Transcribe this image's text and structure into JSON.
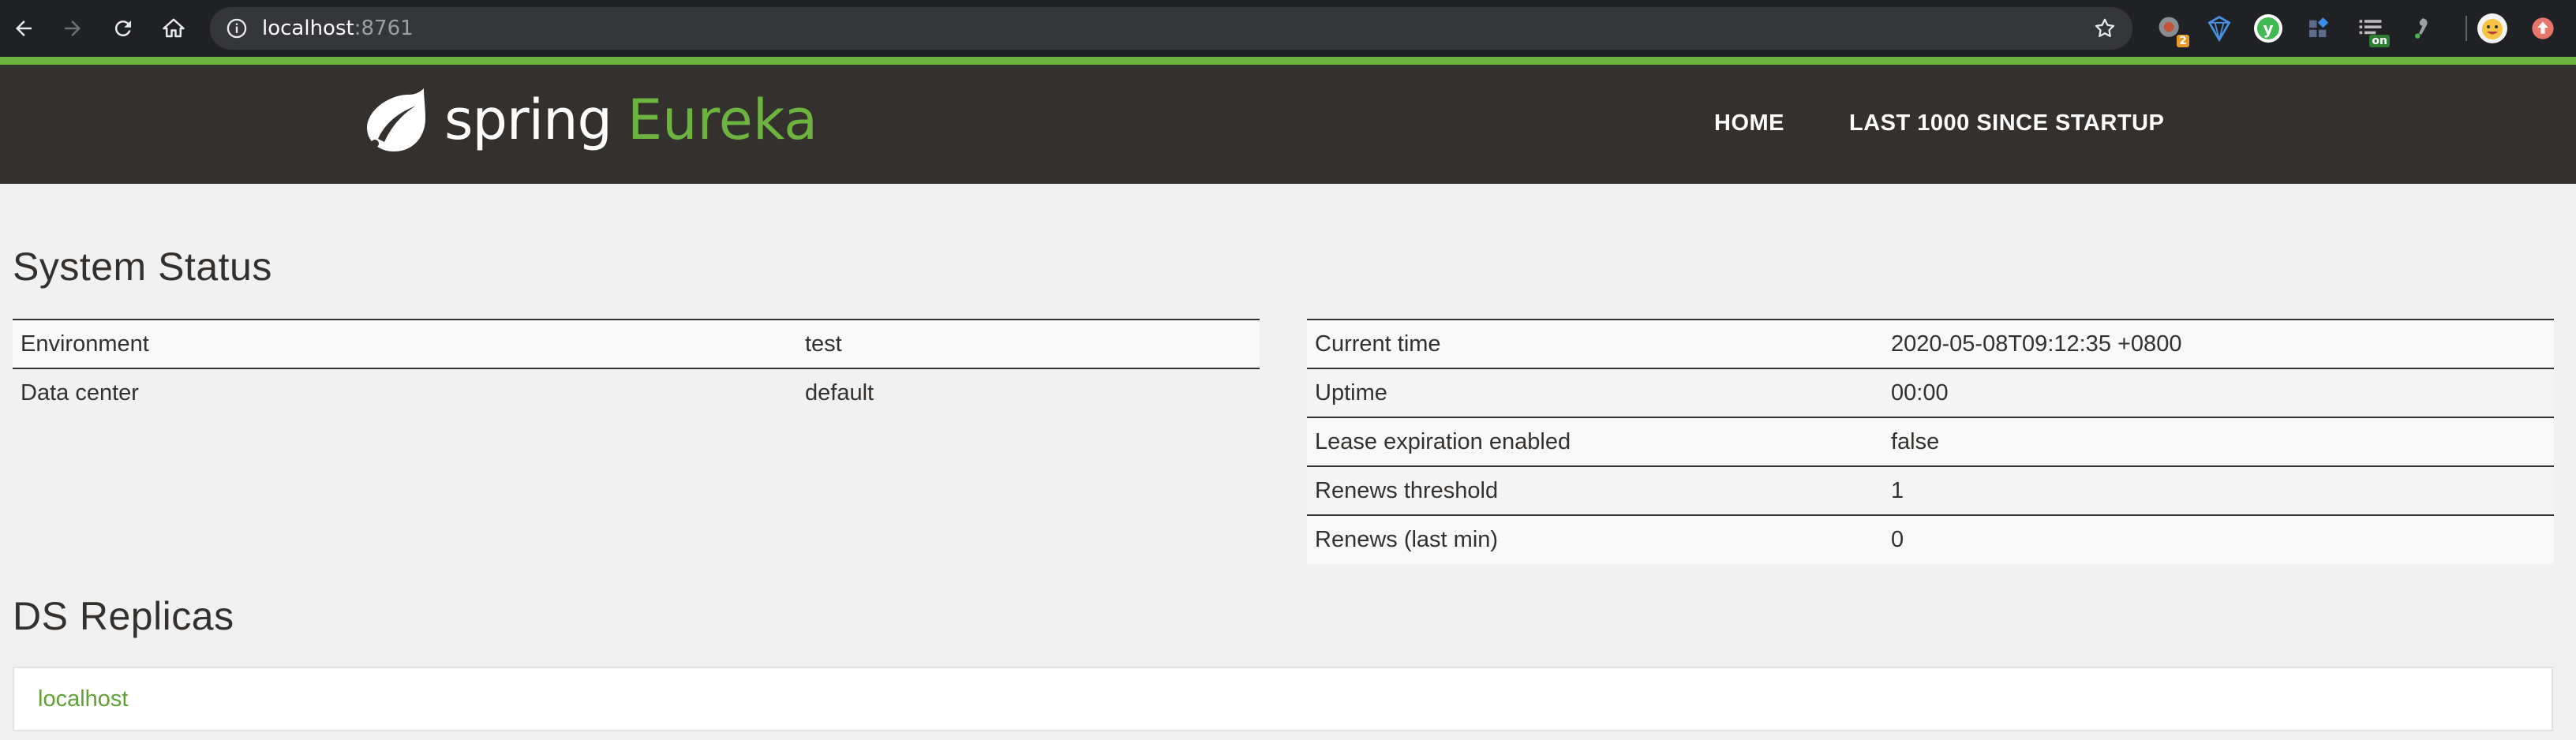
{
  "browser": {
    "url_host": "localhost",
    "url_port": ":8761",
    "extensions": [
      {
        "name": "extension-1",
        "badge": "2"
      },
      {
        "name": "extension-2",
        "badge": ""
      },
      {
        "name": "extension-3",
        "badge": ""
      },
      {
        "name": "extension-4",
        "badge": ""
      },
      {
        "name": "extension-5",
        "badge": "on"
      },
      {
        "name": "extension-6",
        "badge": ""
      }
    ]
  },
  "header": {
    "logo_spring": "spring",
    "logo_eureka": "Eureka",
    "nav": [
      {
        "label": "HOME"
      },
      {
        "label": "LAST 1000 SINCE STARTUP"
      }
    ]
  },
  "system_status": {
    "title": "System Status",
    "left_table": [
      {
        "label": "Environment",
        "value": "test"
      },
      {
        "label": "Data center",
        "value": "default"
      }
    ],
    "right_table": [
      {
        "label": "Current time",
        "value": "2020-05-08T09:12:35 +0800"
      },
      {
        "label": "Uptime",
        "value": "00:00"
      },
      {
        "label": "Lease expiration enabled",
        "value": "false"
      },
      {
        "label": "Renews threshold",
        "value": "1"
      },
      {
        "label": "Renews (last min)",
        "value": "0"
      }
    ]
  },
  "ds_replicas": {
    "title": "DS Replicas",
    "items": [
      {
        "label": "localhost"
      }
    ]
  },
  "colors": {
    "brand_green": "#6db33f",
    "header_bg": "#34302d",
    "page_bg": "#f1f1f1"
  }
}
